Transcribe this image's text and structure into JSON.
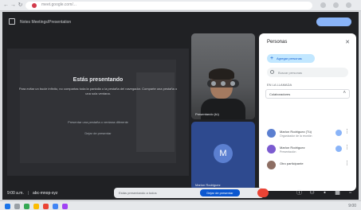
{
  "browser": {
    "url": "meet.google.com/...",
    "nav": [
      "←",
      "→",
      "↻"
    ]
  },
  "meet": {
    "doc_title": "Notes Meetings/Presentation",
    "presentation": {
      "title": "Estás presentando",
      "description": "Para evitar un bucle infinito, no compartas toda la pantalla o la pestaña del navegador. Comparte una pestaña o una sola ventana.",
      "action_primary": "Presentar una pestaña o ventana diferente",
      "action_secondary": "Dejar de presentar"
    },
    "tiles": {
      "self_name": "Presentando (tú)",
      "avatar_initial": "M",
      "avatar_name": "Marlon Rodriguez"
    },
    "people_panel": {
      "title": "Personas",
      "close": "✕",
      "add_label": "Agregar personas",
      "search_placeholder": "Buscar personas",
      "section": "EN LA LLAMADA",
      "contributors_label": "Colaboradores",
      "people": [
        {
          "name": "Marlon Rodriguez (Tú)",
          "sub": "Organizador de la reunión",
          "color": "#5b7fd0"
        },
        {
          "name": "Marlon Rodriguez",
          "sub": "Presentación",
          "color": "#7b5bd0"
        },
        {
          "name": "Otro participante",
          "sub": "",
          "color": "#8d6e63"
        }
      ]
    },
    "bottom": {
      "time": "9:00 a.m.",
      "separator": "|",
      "code": "abc-mnop-xyz",
      "notice_text": "Estás presentando a todos",
      "notice_button": "Dejar de presentar"
    }
  },
  "taskbar": {
    "tray": "9:00"
  },
  "colors": {
    "meet_bg": "#202124",
    "accent": "#8ab4f8",
    "hangup": "#ea4335",
    "primary_button": "#0b57d0"
  }
}
